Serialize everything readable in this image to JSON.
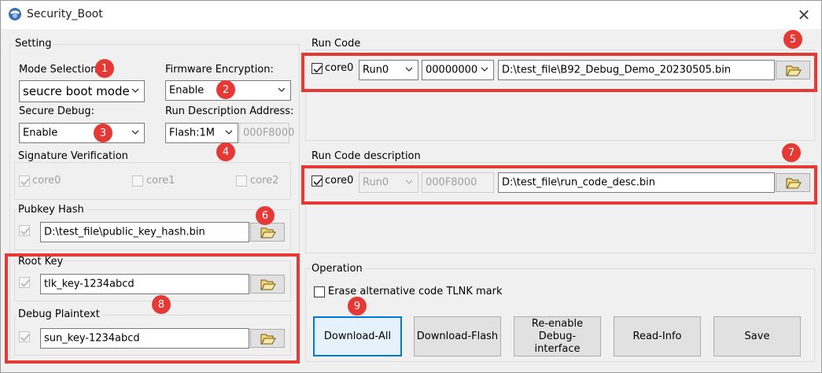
{
  "window": {
    "title": "Security_Boot",
    "close_label": "✕"
  },
  "setting": {
    "legend": "Setting",
    "mode_label": "Mode Selection:",
    "mode_value": "seucre boot mode",
    "fw_enc_label": "Firmware Encryption:",
    "fw_enc_value": "Enable",
    "secure_debug_label": "Secure Debug:",
    "secure_debug_value": "Enable",
    "run_desc_addr_label": "Run Description Address:",
    "flash_value": "Flash:1M",
    "flash_addr": "000F8000",
    "sig_legend": "Signature  Verification",
    "sig_cores": [
      "core0",
      "core1",
      "core2"
    ],
    "pubkey_legend": "Pubkey Hash",
    "pubkey_path": "D:\\test_file\\public_key_hash.bin",
    "rootkey_legend": "Root Key",
    "rootkey_value": "tlk_key-1234abcd",
    "debug_legend": "Debug Plaintext",
    "debug_value": "sun_key-1234abcd"
  },
  "run_code": {
    "legend": "Run Code",
    "core_label": "core0",
    "run_value": "Run0",
    "addr_value": "00000000",
    "path": "D:\\test_file\\B92_Debug_Demo_20230505.bin"
  },
  "run_desc": {
    "legend": "Run Code description",
    "core_label": "core0",
    "run_value": "Run0",
    "addr_value": "000F8000",
    "path": "D:\\test_file\\run_code_desc.bin"
  },
  "operation": {
    "legend": "Operation",
    "erase_label": "Erase alternative code TLNK mark",
    "buttons": [
      "Download-All",
      "Download-Flash",
      "Re-enable Debug-interface",
      "Read-Info",
      "Save"
    ]
  },
  "badges": [
    "1",
    "2",
    "3",
    "4",
    "5",
    "6",
    "7",
    "8",
    "9"
  ],
  "colors": {
    "highlight": "#e53935",
    "focus": "#0078d7"
  }
}
